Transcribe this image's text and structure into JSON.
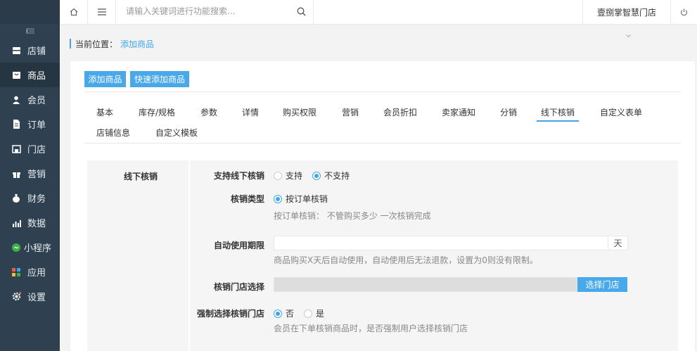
{
  "sidebar": {
    "collapse_icon": "collapse-icon",
    "items": [
      {
        "label": "店铺",
        "icon": "store-icon"
      },
      {
        "label": "商品",
        "icon": "goods-icon"
      },
      {
        "label": "会员",
        "icon": "user-icon"
      },
      {
        "label": "订单",
        "icon": "order-icon"
      },
      {
        "label": "门店",
        "icon": "shop-icon"
      },
      {
        "label": "营销",
        "icon": "gift-icon"
      },
      {
        "label": "财务",
        "icon": "money-bag-icon"
      },
      {
        "label": "数据",
        "icon": "chart-icon"
      },
      {
        "label": "小程序",
        "icon": "miniprogram-icon"
      },
      {
        "label": "应用",
        "icon": "apps-icon"
      },
      {
        "label": "设置",
        "icon": "gear-icon"
      }
    ],
    "active_index": 1
  },
  "topbar": {
    "search_placeholder": "请输入关键词进行功能搜索...",
    "shop_name": "壹捌掌智慧门店"
  },
  "breadcrumb": {
    "current_label": "当前位置：",
    "link": "添加商品"
  },
  "actions": {
    "add_goods": "添加商品",
    "quick_add_goods": "快速添加商品"
  },
  "tabs": {
    "row1": [
      "基本",
      "库存/规格",
      "参数",
      "详情",
      "购买权限",
      "营销",
      "会员折扣",
      "卖家通知",
      "分销",
      "线下核销",
      "自定义表单"
    ],
    "row2": [
      "店铺信息",
      "自定义模板"
    ],
    "active": "线下核销"
  },
  "panel": {
    "title": "线下核销",
    "support_label": "支持线下核销",
    "support_options": [
      "支持",
      "不支持"
    ],
    "support_selected": "不支持",
    "type_label": "核销类型",
    "type_option": "按订单核销",
    "type_hint": "按订单核销： 不管购买多少 一次核销完成",
    "period_label": "自动使用期限",
    "period_value": "",
    "period_unit": "天",
    "period_hint": "商品购买X天后自动使用，自动使用后无法退款，设置为0则没有限制。",
    "store_label": "核销门店选择",
    "store_button": "选择门店",
    "force_label": "强制选择核销门店",
    "force_options": [
      "否",
      "是"
    ],
    "force_selected": "否",
    "force_hint": "会员在下单核销商品时，是否强制用户选择核销门店"
  },
  "colors": {
    "sidebar_bg": "#2f4050",
    "accent": "#3ea6e8",
    "button_bg": "#48a8ea"
  }
}
